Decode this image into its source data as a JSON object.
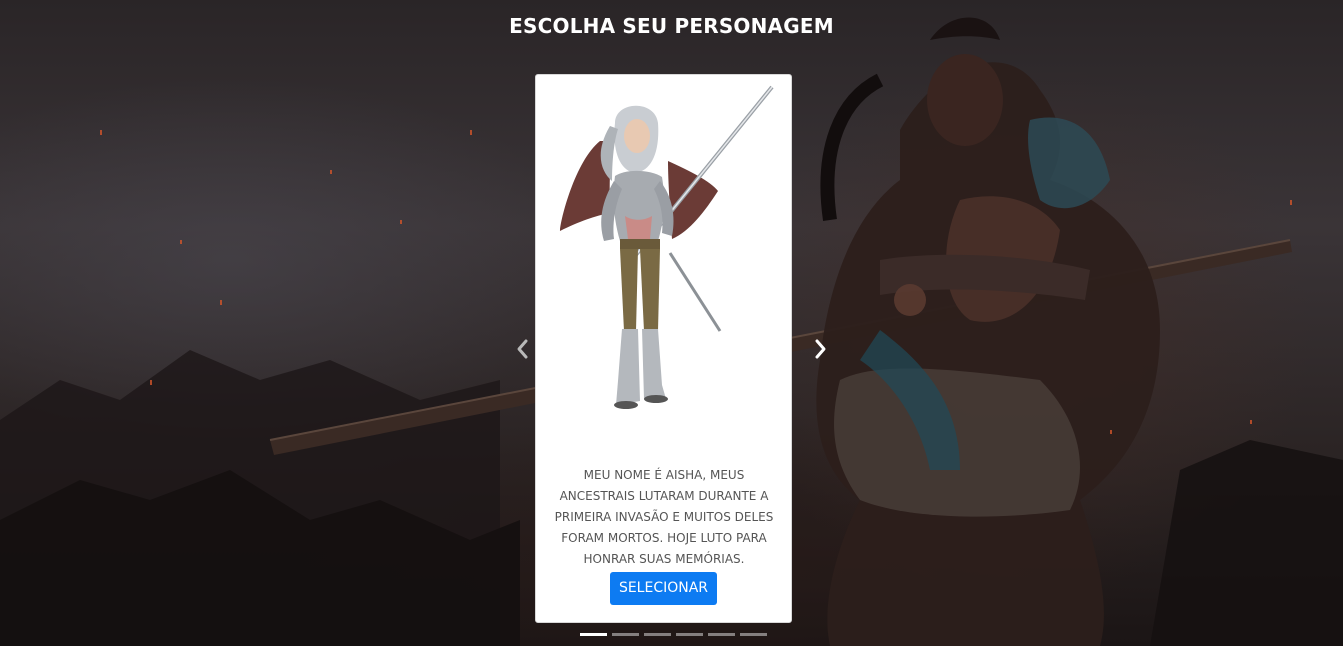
{
  "page": {
    "title": "ESCOLHA SEU PERSONAGEM"
  },
  "carousel": {
    "active_index": 0,
    "slide_count": 6,
    "prev_icon": "chevron-left-icon",
    "next_icon": "chevron-right-icon",
    "card": {
      "image_icon": "character-portrait",
      "description": "MEU NOME É AISHA, MEUS ANCESTRAIS LUTARAM DURANTE A PRIMEIRA INVASÃO E MUITOS DELES FORAM MORTOS. HOJE LUTO PARA HONRAR SUAS MEMÓRIAS.",
      "select_label": "SELECIONAR"
    }
  },
  "colors": {
    "accent": "#0d7bf2",
    "card_bg": "#ffffff",
    "text_muted": "#555555"
  }
}
